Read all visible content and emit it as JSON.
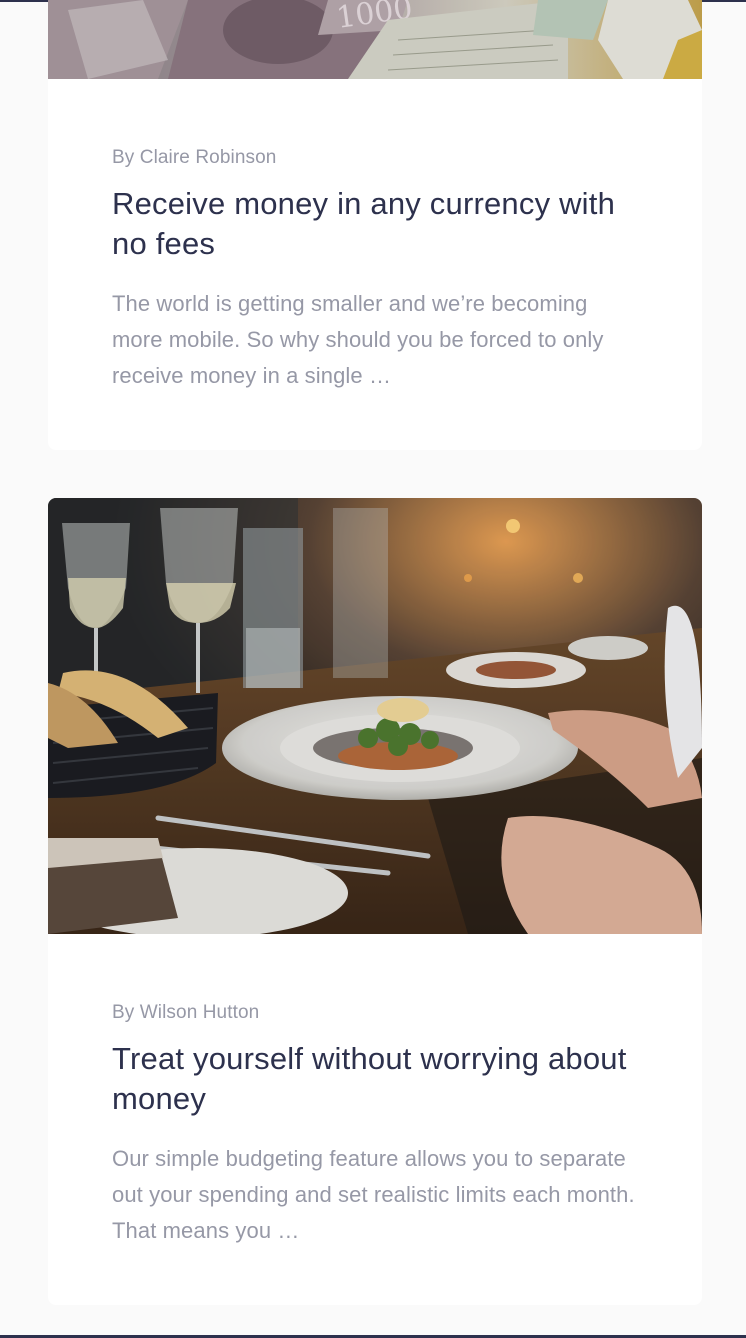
{
  "articles": [
    {
      "image_alt": "currency notes",
      "author": "By Claire Robinson",
      "title": "Receive money in any currency with no fees",
      "excerpt": "The world is getting smaller and we’re becoming more mobile. So why should you be forced to only receive money in a single …"
    },
    {
      "image_alt": "restaurant dinner",
      "author": "By Wilson Hutton",
      "title": "Treat yourself without worrying about money",
      "excerpt": "Our simple budgeting feature allows you to separate out your spending and set realistic limits each month. That means you …"
    }
  ],
  "colors": {
    "page_bg": "#fafafa",
    "card_bg": "#ffffff",
    "heading": "#2d314d",
    "muted": "#9698a6"
  }
}
